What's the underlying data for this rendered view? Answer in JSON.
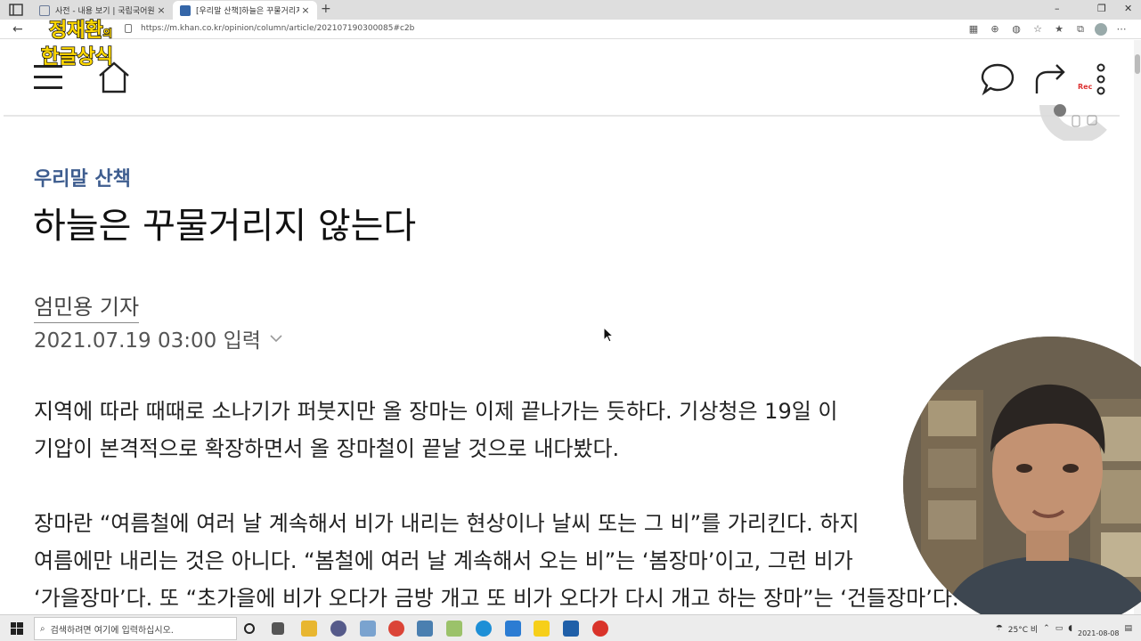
{
  "browser": {
    "tabs": [
      {
        "title": "사전 - 내용 보기 | 국립국어원 표",
        "favicon_color": "#6b7b99"
      },
      {
        "title": "[우리말 산책]하늘은 꾸물거리지 ",
        "favicon_color": "#3566a8",
        "active": true
      }
    ],
    "new_tab_glyph": "+",
    "close_glyph": "×",
    "window_controls": [
      "–",
      "❐",
      "✕"
    ],
    "url": "https://m.khan.co.kr/opinion/column/article/202107190300085#c2b"
  },
  "overlay": {
    "logo_line1": "정재환",
    "logo_line1_suffix": "의",
    "logo_line2": "한글상식",
    "rec_label": "Rec"
  },
  "article": {
    "section": "우리말 산책",
    "headline": "하늘은 꾸물거리지 않는다",
    "byline": "엄민용 기자",
    "date": "2021.07.19 03:00 입력",
    "paragraphs": [
      "지역에 따라 때때로 소나기가 퍼붓지만 올 장마는 이제 끝나가는 듯하다. 기상청은 19일 이",
      "기압이 본격적으로 확장하면서 올 장마철이 끝날 것으로 내다봤다.",
      "장마란 “여름철에 여러 날 계속해서 비가 내리는 현상이나 날씨 또는 그 비”를 가리킨다. 하지",
      "여름에만 내리는 것은 아니다. “봄철에 여러 날 계속해서 오는 비”는 ‘봄장마’이고, 그런 비가",
      "‘가을장마’다. 또 “초가을에 비가 오다가 금방 개고 또 비가 오다가 다시 개고 하는 장마”는 ‘건들장마’다."
    ]
  },
  "taskbar": {
    "search_placeholder": "검색하려면 여기에 입력하십시오.",
    "weather": "25°C 비",
    "date": "2021-08-08"
  },
  "colors": {
    "section_label": "#3e5d8f",
    "logo_fill": "#ffd800"
  }
}
